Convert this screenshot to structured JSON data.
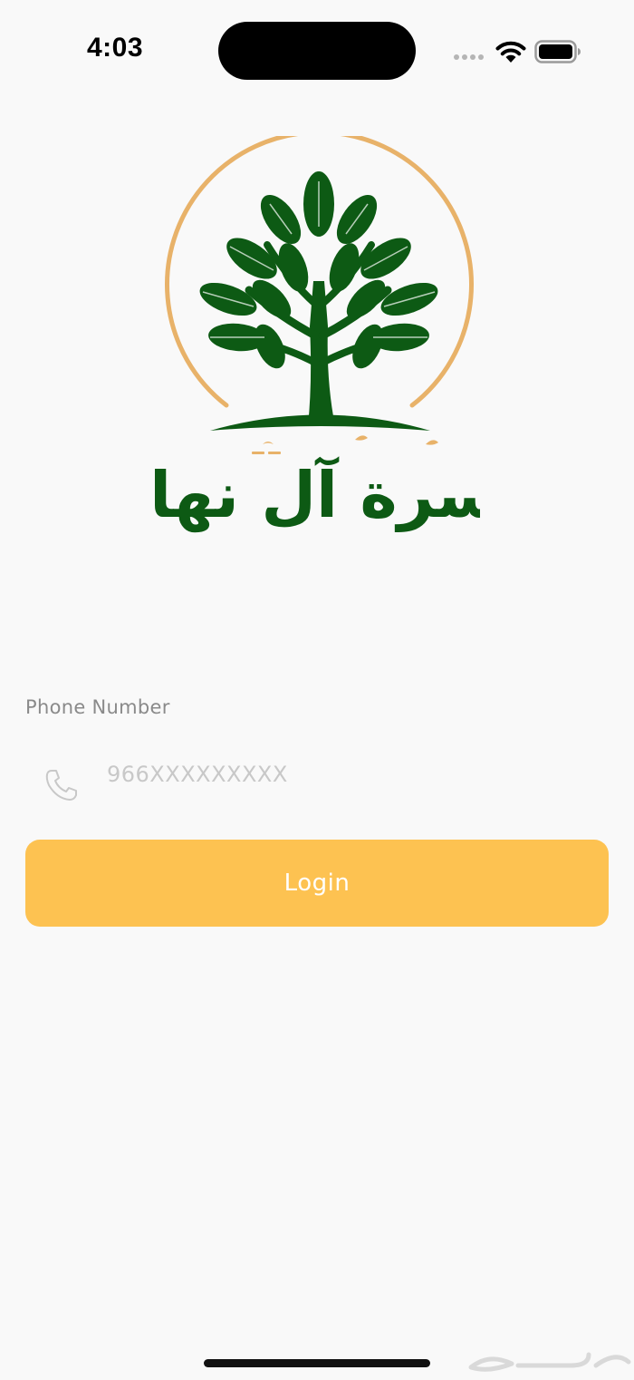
{
  "status_bar": {
    "time": "4:03"
  },
  "logo": {
    "arabic_text": "أسرة آل نهار",
    "icon": "tree-logo-icon",
    "colors": {
      "tree": "#0d5a14",
      "ring": "#e8b269"
    }
  },
  "login_form": {
    "phone_label": "Phone Number",
    "phone_placeholder": "966XXXXXXXXX",
    "phone_value": "",
    "phone_icon": "phone-icon",
    "login_label": "Login"
  },
  "colors": {
    "background": "#f9f9f9",
    "accent": "#fdc251",
    "button_text": "#ffffff"
  },
  "watermark": {
    "text": "حراج"
  }
}
